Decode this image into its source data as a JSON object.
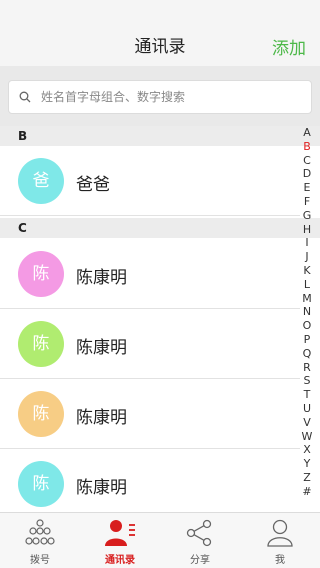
{
  "header": {
    "title": "通讯录",
    "add_label": "添加"
  },
  "search": {
    "placeholder": "姓名首字母组合、数字搜索"
  },
  "sections": [
    {
      "letter": "B"
    },
    {
      "letter": "C"
    }
  ],
  "contacts": [
    {
      "name": "爸爸",
      "avatar_char": "爸",
      "avatar_color": "#7fe8e8"
    },
    {
      "name": "陈康明",
      "avatar_char": "陈",
      "avatar_color": "#f49ae4"
    },
    {
      "name": "陈康明",
      "avatar_char": "陈",
      "avatar_color": "#b0ec70"
    },
    {
      "name": "陈康明",
      "avatar_char": "陈",
      "avatar_color": "#f7cd85"
    },
    {
      "name": "陈康明",
      "avatar_char": "陈",
      "avatar_color": "#7fe8e8"
    }
  ],
  "index_letters": [
    "A",
    "B",
    "C",
    "D",
    "E",
    "F",
    "G",
    "H",
    "I",
    "J",
    "K",
    "L",
    "M",
    "N",
    "O",
    "P",
    "Q",
    "R",
    "S",
    "T",
    "U",
    "V",
    "W",
    "X",
    "Y",
    "Z",
    "#"
  ],
  "index_active": "B",
  "tabs": [
    {
      "label": "拨号",
      "icon": "dialpad-icon"
    },
    {
      "label": "通讯录",
      "icon": "contacts-icon",
      "active": true
    },
    {
      "label": "分享",
      "icon": "share-icon"
    },
    {
      "label": "我",
      "icon": "person-icon"
    }
  ],
  "colors": {
    "accent_green": "#4cb848",
    "active_red": "#d81e1e"
  }
}
